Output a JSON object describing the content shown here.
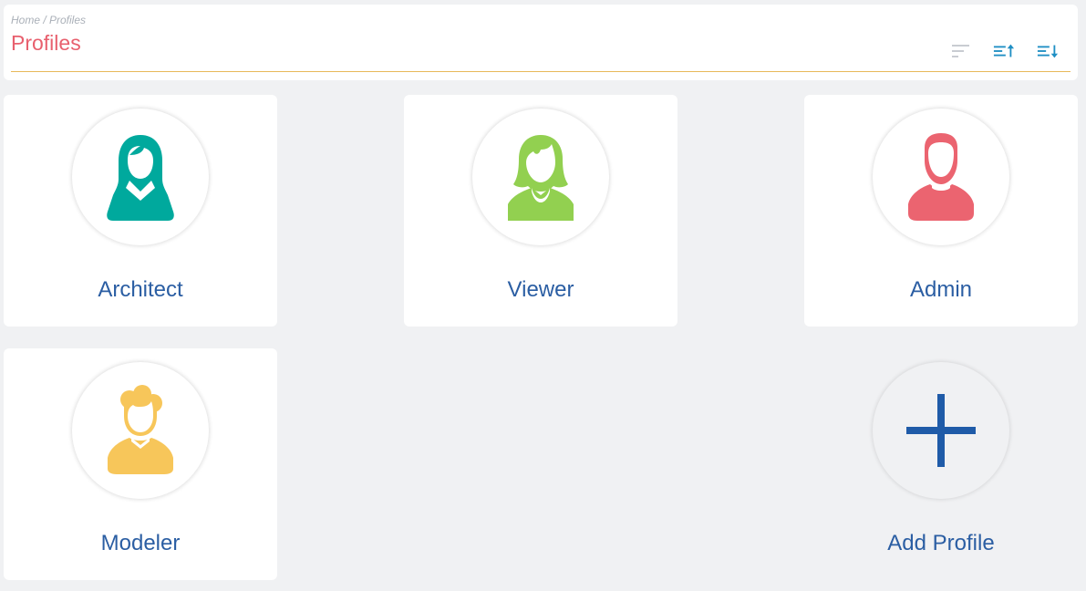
{
  "header": {
    "breadcrumb": "Home / Profiles",
    "title": "Profiles",
    "sort_buttons": [
      {
        "icon": "sort-lines-icon",
        "color": "#c9ccd2"
      },
      {
        "icon": "sort-ascending-icon",
        "color": "#1f8fc4"
      },
      {
        "icon": "sort-descending-icon",
        "color": "#1f8fc4"
      }
    ]
  },
  "profiles": [
    {
      "label": "Architect",
      "icon": "woman-hijab-avatar-icon",
      "color": "#00a99d"
    },
    {
      "label": "Viewer",
      "icon": "woman-avatar-icon",
      "color": "#92d050"
    },
    {
      "label": "Admin",
      "icon": "man-avatar-icon",
      "color": "#eb6470"
    },
    {
      "label": "Modeler",
      "icon": "man-curly-avatar-icon",
      "color": "#f7c65a"
    }
  ],
  "add_profile": {
    "label": "Add Profile",
    "icon": "plus-icon",
    "color": "#1f5ba8"
  },
  "colors": {
    "title": "#e8606e",
    "accent_rule": "#e7b95a",
    "label": "#2b5ea3",
    "background": "#f0f1f3"
  }
}
